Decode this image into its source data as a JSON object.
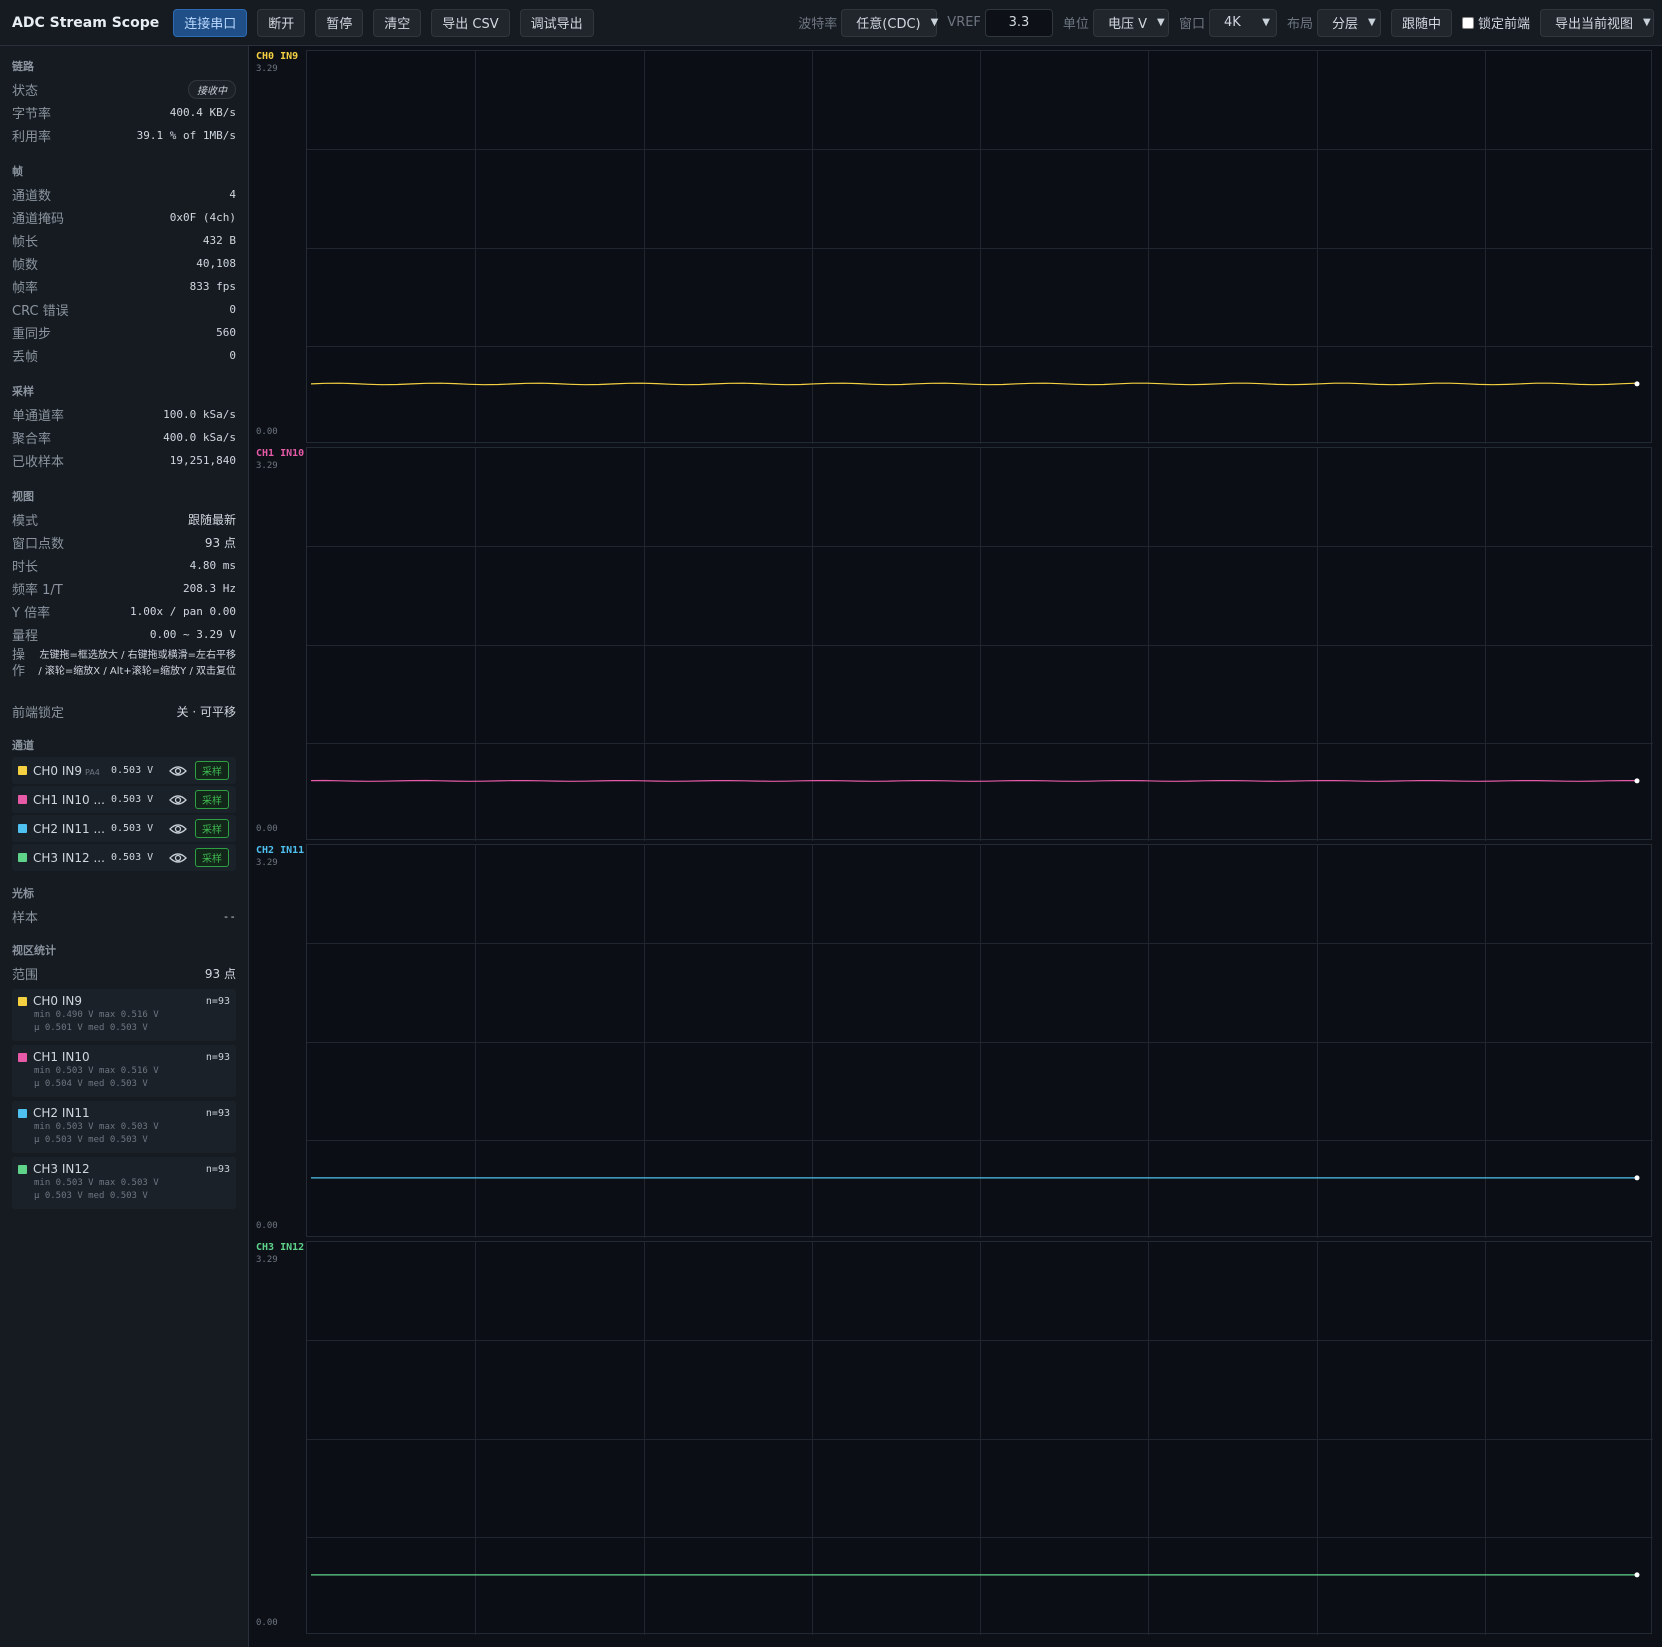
{
  "app": {
    "title": "ADC Stream Scope"
  },
  "toolbar": {
    "connect": "连接串口",
    "disconnect": "断开",
    "pause": "暂停",
    "clear": "清空",
    "export_csv": "导出 CSV",
    "debug_export": "调试导出",
    "baud_label": "波特率",
    "baud_value": "任意(CDC)",
    "vref_label": "VREF",
    "vref_value": "3.3",
    "unit_label": "单位",
    "unit_value": "电压 V",
    "window_label": "窗口",
    "window_value": "4K",
    "layout_label": "布局",
    "layout_value": "分层",
    "follow": "跟随中",
    "lock_front": "锁定前端",
    "export_view": "导出当前视图"
  },
  "sidebar": {
    "link": {
      "title": "链路",
      "status_k": "状态",
      "status_v": "接收中",
      "bytes_k": "字节率",
      "bytes_v": "400.4 KB/s",
      "util_k": "利用率",
      "util_v": "39.1 % of 1MB/s"
    },
    "frame": {
      "title": "帧",
      "rows": [
        {
          "k": "通道数",
          "v": "4"
        },
        {
          "k": "通道掩码",
          "v": "0x0F (4ch)"
        },
        {
          "k": "帧长",
          "v": "432 B"
        },
        {
          "k": "帧数",
          "v": "40,108"
        },
        {
          "k": "帧率",
          "v": "833 fps"
        },
        {
          "k": "CRC 错误",
          "v": "0"
        },
        {
          "k": "重同步",
          "v": "560"
        },
        {
          "k": "丢帧",
          "v": "0"
        }
      ]
    },
    "sampling": {
      "title": "采样",
      "rows": [
        {
          "k": "单通道率",
          "v": "100.0 kSa/s"
        },
        {
          "k": "聚合率",
          "v": "400.0 kSa/s"
        },
        {
          "k": "已收样本",
          "v": "19,251,840"
        }
      ]
    },
    "view": {
      "title": "视图",
      "rows": [
        {
          "k": "模式",
          "v": "跟随最新"
        },
        {
          "k": "窗口点数",
          "v": "93 点"
        },
        {
          "k": "时长",
          "v": "4.80 ms"
        },
        {
          "k": "频率 1/T",
          "v": "208.3 Hz"
        },
        {
          "k": "Y 倍率",
          "v": "1.00x / pan 0.00"
        },
        {
          "k": "量程",
          "v": "0.00 ~ 3.29 V"
        }
      ],
      "ops_k": "操作",
      "ops_v": "左键拖=框选放大 / 右键拖或横滑=左右平移 / 滚轮=缩放X / Alt+滚轮=缩放Y / 双击复位",
      "lock_k": "前端锁定",
      "lock_v": "关 · 可平移"
    },
    "channels": {
      "title": "通道",
      "items": [
        {
          "name": "CH0 IN9",
          "pin": "PA4",
          "value": "0.503 V",
          "tag": "采样",
          "color": "#f5d142"
        },
        {
          "name": "CH1 IN10 ...",
          "pin": "",
          "value": "0.503 V",
          "tag": "采样",
          "color": "#e65aa8"
        },
        {
          "name": "CH2 IN11 ...",
          "pin": "",
          "value": "0.503 V",
          "tag": "采样",
          "color": "#4fc1f0"
        },
        {
          "name": "CH3 IN12 ...",
          "pin": "",
          "value": "0.503 V",
          "tag": "采样",
          "color": "#5fd38a"
        }
      ]
    },
    "cursor": {
      "title": "光标",
      "sample_k": "样本",
      "sample_v": "--"
    },
    "stats": {
      "title": "视区统计",
      "range_k": "范围",
      "range_v": "93 点",
      "items": [
        {
          "name": "CH0 IN9",
          "n": "n=93",
          "line1": "min 0.490 V max 0.516 V",
          "line2": "μ 0.501 V med 0.503 V",
          "color": "#f5d142"
        },
        {
          "name": "CH1 IN10",
          "n": "n=93",
          "line1": "min 0.503 V max 0.516 V",
          "line2": "μ 0.504 V med 0.503 V",
          "color": "#e65aa8"
        },
        {
          "name": "CH2 IN11",
          "n": "n=93",
          "line1": "min 0.503 V max 0.503 V",
          "line2": "μ 0.503 V med 0.503 V",
          "color": "#4fc1f0"
        },
        {
          "name": "CH3 IN12",
          "n": "n=93",
          "line1": "min 0.503 V max 0.503 V",
          "line2": "μ 0.503 V med 0.503 V",
          "color": "#5fd38a"
        }
      ]
    }
  },
  "plots": [
    {
      "label": "CH0 IN9",
      "ymax": "3.29",
      "ymin": "0.00",
      "color": "#f5d142"
    },
    {
      "label": "CH1 IN10",
      "ymax": "3.29",
      "ymin": "0.00",
      "color": "#e65aa8"
    },
    {
      "label": "CH2 IN11",
      "ymax": "3.29",
      "ymin": "0.00",
      "color": "#4fc1f0"
    },
    {
      "label": "CH3 IN12",
      "ymax": "3.29",
      "ymin": "0.00",
      "color": "#5fd38a"
    }
  ],
  "chart_data": [
    {
      "type": "line",
      "title": "CH0 IN9",
      "ylim": [
        0,
        3.29
      ],
      "x_points": 93,
      "series": [
        {
          "name": "CH0 IN9",
          "level": 0.503,
          "min": 0.49,
          "max": 0.516
        }
      ],
      "grid": true
    },
    {
      "type": "line",
      "title": "CH1 IN10",
      "ylim": [
        0,
        3.29
      ],
      "x_points": 93,
      "series": [
        {
          "name": "CH1 IN10",
          "level": 0.503,
          "min": 0.503,
          "max": 0.516
        }
      ],
      "grid": true
    },
    {
      "type": "line",
      "title": "CH2 IN11",
      "ylim": [
        0,
        3.29
      ],
      "x_points": 93,
      "series": [
        {
          "name": "CH2 IN11",
          "level": 0.503,
          "min": 0.503,
          "max": 0.503
        }
      ],
      "grid": true
    },
    {
      "type": "line",
      "title": "CH3 IN12",
      "ylim": [
        0,
        3.29
      ],
      "x_points": 93,
      "series": [
        {
          "name": "CH3 IN12",
          "level": 0.503,
          "min": 0.503,
          "max": 0.503
        }
      ],
      "grid": true
    }
  ]
}
